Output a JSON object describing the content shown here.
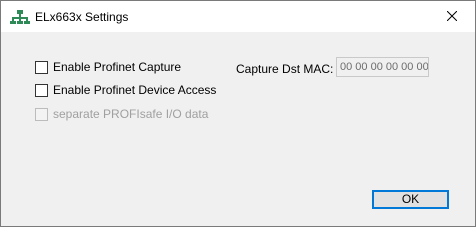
{
  "window": {
    "title": "ELx663x Settings"
  },
  "options": {
    "enable_capture": {
      "label": "Enable Profinet Capture",
      "checked": false
    },
    "enable_device_access": {
      "label": "Enable Profinet Device Access",
      "checked": false
    },
    "separate_profisafe": {
      "label": "separate PROFIsafe I/O data",
      "checked": false,
      "enabled": false
    }
  },
  "capture_mac": {
    "label": "Capture Dst MAC:",
    "value": "00 00 00 00 00 00"
  },
  "buttons": {
    "ok_label": "OK"
  },
  "icons": {
    "app": "network-tree-icon",
    "close": "close-icon"
  },
  "colors": {
    "accent": "#0078d7",
    "icon_green": "#2e8b57"
  }
}
